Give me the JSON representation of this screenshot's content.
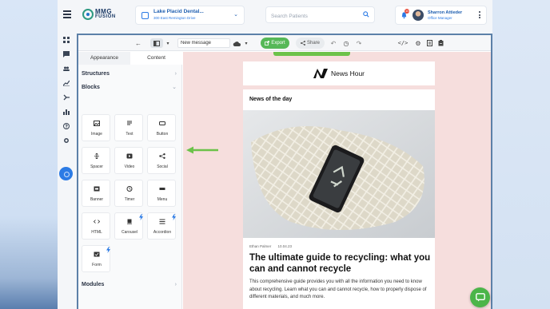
{
  "header": {
    "logo_line1": "MMG",
    "logo_line2": "FUSION",
    "practice_name": "Lake Placid Dental...",
    "practice_address": "300 East Remington Drive",
    "search_placeholder": "Search Patients",
    "notification_count": "10",
    "user_name": "Sharron Attieder",
    "user_role": "Office Manager"
  },
  "rail": {
    "icons": [
      "grid-icon",
      "chat-icon",
      "users-icon",
      "chart-icon",
      "flow-icon",
      "bar-chart-icon",
      "help-icon",
      "settings-icon"
    ]
  },
  "toolbar": {
    "message_name": "New message",
    "export_label": "Export",
    "share_label": "Share"
  },
  "panel": {
    "tabs": [
      "Appearance",
      "Content"
    ],
    "structures_label": "Structures",
    "blocks_label": "Blocks",
    "modules_label": "Modules",
    "blocks": [
      {
        "label": "Image",
        "pro": false
      },
      {
        "label": "Text",
        "pro": false
      },
      {
        "label": "Button",
        "pro": false
      },
      {
        "label": "Spacer",
        "pro": false
      },
      {
        "label": "Video",
        "pro": false
      },
      {
        "label": "Social",
        "pro": false
      },
      {
        "label": "Banner",
        "pro": false
      },
      {
        "label": "Timer",
        "pro": false
      },
      {
        "label": "Menu",
        "pro": false
      },
      {
        "label": "HTML",
        "pro": false
      },
      {
        "label": "Carousel",
        "pro": true
      },
      {
        "label": "Accordion",
        "pro": true
      },
      {
        "label": "Form",
        "pro": true
      }
    ]
  },
  "email": {
    "brand": "News Hour",
    "section_title": "News of the day",
    "author": "Ethan Palmer",
    "date": "10.04.23",
    "article_title": "The ultimate guide to recycling: what you can and cannot recycle",
    "article_body": "This comprehensive guide provides you with all the information you need to know about recycling. Learn what you can and cannot recycle, how to properly dispose of different materials, and much more."
  },
  "colors": {
    "accent": "#2c7be5",
    "export_green": "#56b857",
    "canvas_bg": "#f6dedd",
    "annotation_arrow": "#6cc24a"
  }
}
